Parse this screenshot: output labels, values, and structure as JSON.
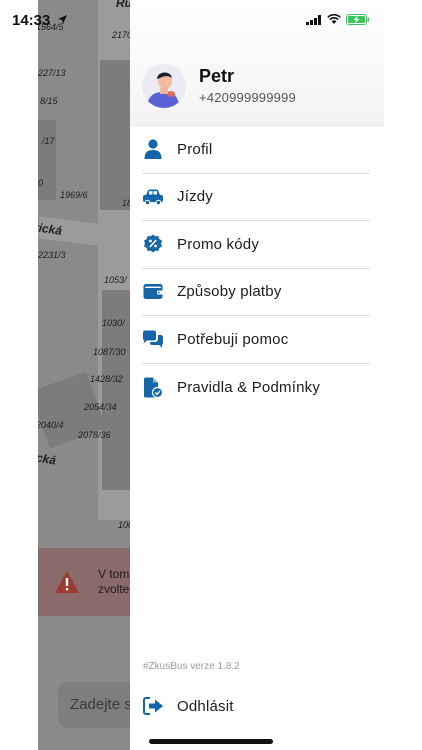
{
  "status_bar": {
    "time": "14:33"
  },
  "background": {
    "street_names": [
      "Ruské",
      "rická",
      "cká"
    ],
    "parcel_numbers": [
      "1564/5",
      "2170",
      "227/13",
      "8/15",
      "/17",
      "0",
      "1969/6",
      "18",
      "2231/3",
      "1053/",
      "1030/",
      "1087/30",
      "1428/32",
      "2054/34",
      "2040/4",
      "2078/36",
      "100"
    ],
    "alert_text_lines": [
      "V tom",
      "zvolte"
    ],
    "search_placeholder": "Zadejte s"
  },
  "drawer": {
    "user": {
      "name": "Petr",
      "phone": "+420999999999"
    },
    "menu": [
      {
        "label": "Profil",
        "icon": "user-icon"
      },
      {
        "label": "Jízdy",
        "icon": "car-icon"
      },
      {
        "label": "Promo kódy",
        "icon": "promo-badge-icon"
      },
      {
        "label": "Způsoby platby",
        "icon": "wallet-icon"
      },
      {
        "label": "Potřebuji pomoc",
        "icon": "chat-bubbles-icon"
      },
      {
        "label": "Pravidla & Podmínky",
        "icon": "document-check-icon"
      }
    ],
    "version": "#ZkusBus verze 1.8.2",
    "logout_label": "Odhlásit"
  },
  "colors": {
    "accent": "#1565a9",
    "alert": "#c0392b",
    "battery": "#34c759"
  }
}
